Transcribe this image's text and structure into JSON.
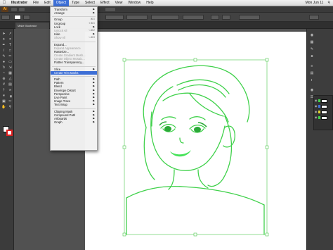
{
  "menubar": {
    "apple": "",
    "items": [
      "Illustrator",
      "File",
      "Edit",
      "Object",
      "Type",
      "Select",
      "Effect",
      "View",
      "Window",
      "Help"
    ],
    "active_index": 3,
    "clock": "Mon Jun 11"
  },
  "document": {
    "tab_label": "Make Illustrator"
  },
  "object_menu": {
    "items": [
      {
        "label": "Transform",
        "submenu": true
      },
      {
        "label": "Arrange",
        "submenu": true
      },
      {
        "sep": true
      },
      {
        "label": "Group",
        "shortcut": "⌘G"
      },
      {
        "label": "Ungroup",
        "shortcut": "⇧⌘G"
      },
      {
        "label": "Lock",
        "submenu": true
      },
      {
        "label": "Unlock All",
        "shortcut": "⌥⌘2",
        "disabled": true
      },
      {
        "label": "Hide",
        "submenu": true
      },
      {
        "label": "Show All",
        "shortcut": "⌥⌘3",
        "disabled": true
      },
      {
        "sep": true
      },
      {
        "label": "Expand..."
      },
      {
        "label": "Expand Appearance",
        "disabled": true
      },
      {
        "label": "Rasterize..."
      },
      {
        "label": "Create Gradient Mesh...",
        "disabled": true
      },
      {
        "label": "Create Object Mosaic...",
        "disabled": true
      },
      {
        "label": "Flatten Transparency..."
      },
      {
        "sep": true
      },
      {
        "label": "Slice",
        "submenu": true
      },
      {
        "label": "Create Trim Marks",
        "highlight": true
      },
      {
        "sep": true
      },
      {
        "label": "Path",
        "submenu": true
      },
      {
        "label": "Pattern",
        "submenu": true
      },
      {
        "label": "Blend",
        "submenu": true
      },
      {
        "label": "Envelope Distort",
        "submenu": true
      },
      {
        "label": "Perspective",
        "submenu": true
      },
      {
        "label": "Live Paint",
        "submenu": true
      },
      {
        "label": "Image Trace",
        "submenu": true
      },
      {
        "label": "Text Wrap",
        "submenu": true
      },
      {
        "sep": true
      },
      {
        "label": "Clipping Mask",
        "submenu": true
      },
      {
        "label": "Compound Path",
        "submenu": true
      },
      {
        "label": "Artboards",
        "submenu": true
      },
      {
        "label": "Graph",
        "submenu": true
      }
    ]
  },
  "tools": [
    "selection-icon",
    "direct-selection-icon",
    "magic-wand-icon",
    "lasso-icon",
    "pen-icon",
    "type-icon",
    "line-icon",
    "rectangle-icon",
    "paintbrush-icon",
    "pencil-icon",
    "blob-brush-icon",
    "eraser-icon",
    "rotate-icon",
    "scale-icon",
    "warp-icon",
    "free-transform-icon",
    "shape-builder-icon",
    "perspective-icon",
    "mesh-icon",
    "gradient-icon",
    "eyedropper-icon",
    "blend-icon",
    "symbol-sprayer-icon",
    "graph-icon",
    "artboard-icon",
    "slice-icon",
    "hand-icon",
    "zoom-icon"
  ],
  "colors": {
    "stroke_green": "#3fd14a",
    "selection_green": "#4cc94c",
    "menu_highlight": "#3d6fd6",
    "stroke_swatch": "#e02020"
  }
}
